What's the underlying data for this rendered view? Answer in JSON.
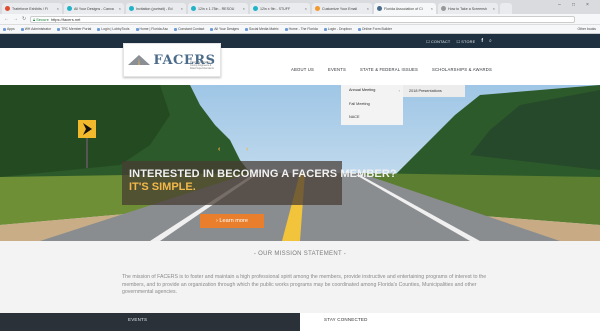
{
  "browser": {
    "tabs": [
      {
        "label": "Trafeforce Exhibits / Fi",
        "color": "#e14b2f"
      },
      {
        "label": "All Your Designs - Canva",
        "color": "#21b4c9"
      },
      {
        "label": "Invitation (portrait) - Ed",
        "color": "#21b4c9"
      },
      {
        "label": "12in x 1.75in - RESOU",
        "color": "#21b4c9"
      },
      {
        "label": "12in x 9in - STUFF",
        "color": "#21b4c9"
      },
      {
        "label": "Customize Your Email",
        "color": "#f29a2e"
      },
      {
        "label": "Florida Association of Ci",
        "color": "#4a6b8a"
      },
      {
        "label": "How to Take a Screensh",
        "color": "#999999"
      }
    ],
    "window_controls": [
      "–",
      "□",
      "×"
    ],
    "secure_label": "Secure",
    "url": "https://facers.net",
    "bookmarks": [
      "Apps",
      "WH Administrator",
      "TRC Member Portal",
      "Login | LobbyTools",
      "Home | Florida Asc",
      "Constant Contact",
      "All Your Designs",
      "Social Media Matrix",
      "Home - The Florida",
      "Login - Dropbox",
      "Online Form Builder",
      "Other books"
    ]
  },
  "topbar": {
    "contact": "☐ CONTACT",
    "store": "☐ STORE",
    "facebook": "f",
    "search": "⌕"
  },
  "logo": {
    "text": "FACERS",
    "subtitle": "Florida Association of County Engineers & Road Superintendents"
  },
  "nav": [
    "ABOUT US",
    "EVENTS",
    "STATE & FEDERAL ISSUES",
    "SCHOLARSHIPS & AWARDS"
  ],
  "dropdown": {
    "items": [
      "Annual Meeting",
      "Fall Meeting",
      "NACE"
    ],
    "sub_items": [
      "2018 Presentations"
    ],
    "arrow": "›"
  },
  "hero": {
    "headline": "INTERESTED IN BECOMING A FACERS MEMBER?",
    "subhead": "IT'S SIMPLE.",
    "cta_label": "› Learn more",
    "arrows": [
      "‹",
      "›"
    ]
  },
  "mission": {
    "title": "- OUR MISSION STATEMENT -",
    "text": "The mission of FACERS is to foster and maintain a high professional spirit among the members, provide instructive and entertaining programs of interest to the members, and to provide an organization through which the public works programs may be coordinated among Florida's Counties, Municipalities and other governmental agencies."
  },
  "footer": {
    "events": "EVENTS",
    "stay_connected": "STAY CONNECTED"
  },
  "colors": {
    "topbar": "#1f3040",
    "accent": "#e97f2c",
    "highlight": "#f4b94a",
    "events_bar": "#2a3138"
  }
}
